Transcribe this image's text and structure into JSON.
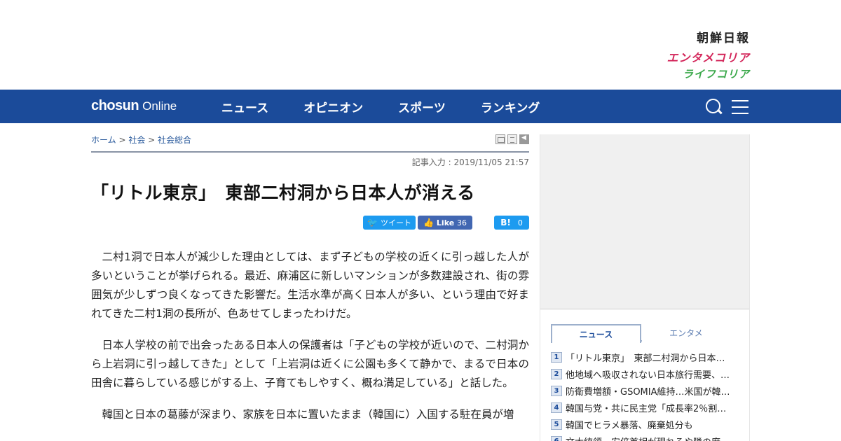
{
  "header": {
    "brand_links": {
      "chosun": "朝鮮日報",
      "entame": "エンタメコリア",
      "life": "ライフコリア"
    }
  },
  "navbar": {
    "logo_bold": "chosun",
    "logo_light": "Online",
    "items": [
      {
        "label": "ニュース"
      },
      {
        "label": "オピニオン"
      },
      {
        "label": "スポーツ"
      },
      {
        "label": "ランキング"
      }
    ],
    "icons": [
      "search-icon",
      "menu-icon"
    ],
    "background": "#1b4b9a"
  },
  "article": {
    "breadcrumb": {
      "home": "ホーム",
      "sep1": " > ",
      "level1": "社会",
      "sep2": " > ",
      "level2": "社会総合"
    },
    "tools": [
      "print-icon",
      "list-icon",
      "back-icon"
    ],
    "datetime": "記事入力 : 2019/11/05 21:57",
    "headline": "「リトル東京」　東部二村洞から日本人が消える",
    "share": {
      "tweet_label": "ツイート",
      "like_label": "Like",
      "like_count": "36",
      "hatena_label": "B!",
      "hatena_count": "0"
    },
    "paragraphs": [
      "二村1洞で日本人が減少した理由としては、まず子どもの学校の近くに引っ越した人が多いということが挙げられる。最近、麻浦区に新しいマンションが多数建設され、街の雰囲気が少しずつ良くなってきた影響だ。生活水準が高く日本人が多い、という理由で好まれてきた二村1洞の長所が、色あせてしまったわけだ。",
      "日本人学校の前で出会ったある日本人の保護者は「子どもの学校が近いので、二村洞から上岩洞に引っ越してきた」として「上岩洞は近くに公園も多くて静かで、まるで日本の田舎に暮らしている感じがする上、子育てもしやすく、概ね満足している」と話した。",
      "韓国と日本の葛藤が深まり、家族を日本に置いたまま（韓国に）入国する駐在員が増"
    ]
  },
  "sidebar": {
    "tabs": [
      {
        "label": "ニュース",
        "active": true
      },
      {
        "label": "エンタメ",
        "active": false
      }
    ],
    "ranking": [
      {
        "num": "1",
        "title": "「リトル東京」　東部二村洞から日本…"
      },
      {
        "num": "2",
        "title": "他地域へ吸収されない日本旅行需要、…"
      },
      {
        "num": "3",
        "title": "防衛費増額・GSOMIA維持…米国が韓…"
      },
      {
        "num": "4",
        "title": "韓国与党・共に民主党「成長率2％割…"
      },
      {
        "num": "5",
        "title": "韓国でヒラメ暴落、廃棄処分も"
      },
      {
        "num": "6",
        "title": "文大統領　安倍首相が現れるや隣の席…"
      }
    ]
  }
}
